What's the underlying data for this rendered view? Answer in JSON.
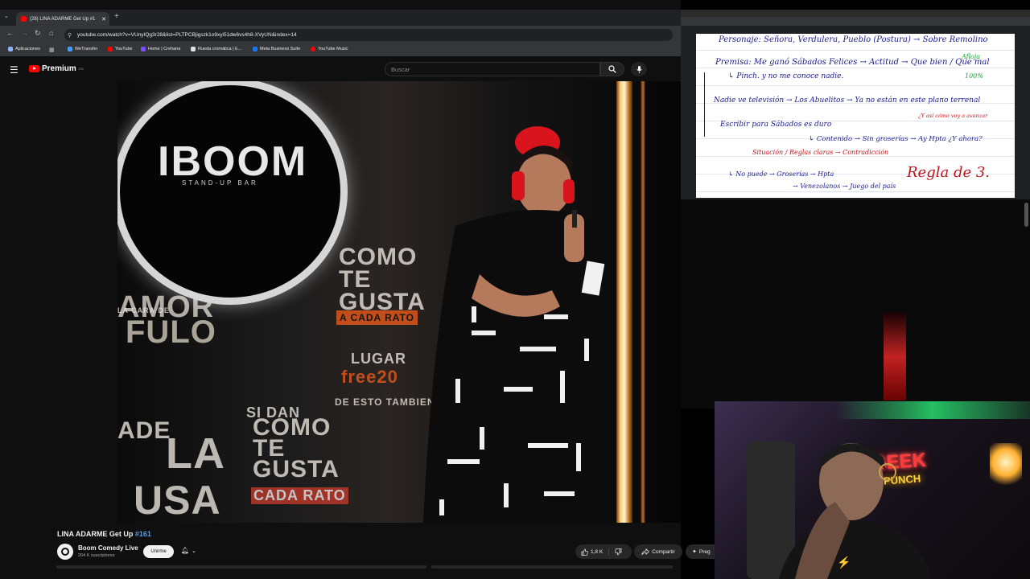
{
  "browser": {
    "tab_title": "(28) LINA ADARME Get Up #1",
    "url": "youtube.com/watch?v=VUnyIQg3r28&list=PLTPCBjigszk1o9xyi51dw6vs4h8-XVyUN&index=14",
    "bookmarks": [
      {
        "label": "Aplicaciones",
        "color": "#8ab4f8"
      },
      {
        "label": "WeTransfer",
        "color": "#409fff"
      },
      {
        "label": "YouTube",
        "color": "#ff0000"
      },
      {
        "label": "Home | Crehana",
        "color": "#7c4dff"
      },
      {
        "label": "Rueda cromática | E...",
        "color": "#e0e0e0"
      },
      {
        "label": "Meta Business Suite",
        "color": "#1877f2"
      },
      {
        "label": "YouTube Music",
        "color": "#ff0000"
      }
    ]
  },
  "youtube": {
    "logo_text": "Premium",
    "logo_sup": "CO",
    "search_placeholder": "Buscar",
    "video_title": "LINA ADARME Get Up ",
    "video_title_hash": "#161",
    "channel_name": "Boom Comedy Live",
    "subscribers": "204 K suscriptores",
    "join_label": "Unirme",
    "likes": "1,8 K",
    "share_label": "Compartir",
    "ask_label": "Preg"
  },
  "video_scene": {
    "logo": "IBOOM",
    "logo_sub": "STAND-UP BAR",
    "wall_texts": [
      "AMOR",
      "COMO TE GUSTA",
      "A CADA RATO",
      "LUGAR",
      "free20",
      "DE ESTO TAMBIEN",
      "COMO TE GUSTA",
      "CADA RATO",
      "LA CARA DE",
      "FULO",
      "SI DAN",
      "ADE",
      "LA",
      "USA"
    ]
  },
  "notes": {
    "lines": [
      {
        "text": "Personaje: Señora, Verdulera, Pueblo  (Postura) → Sobre Remolino",
        "color": "#1a1a8c"
      },
      {
        "text": "Premisa: Me ganó Sábados Felices → Actitud → Que bien / Que mal",
        "color": "#1a1a8c"
      },
      {
        "text": "↳ Pinch. y no me conoce nadie.",
        "color": "#1a1a8c"
      },
      {
        "text": "Nadie ve televisión → Los Abuelitos → Ya no están en este plano terrenal",
        "color": "#1a1a8c"
      },
      {
        "text": "Escribir para Sábados es duro",
        "color": "#1a1a8c"
      },
      {
        "text": "↳ Contenido → Sin groserías → Ay Hpta ¿Y ahora?",
        "color": "#1a1a8c"
      },
      {
        "text": "Situación / Reglas claras → Contradicción",
        "color": "#c0141c"
      },
      {
        "text": "↳ No puede → Groserías → Hpta",
        "color": "#1a1a8c"
      },
      {
        "text": "→ Venezolanos → Juego del país",
        "color": "#1a1a8c"
      },
      {
        "text": "Regla de 3.",
        "color": "#c0141c"
      }
    ],
    "margin_notes": [
      "Afloja",
      "100%",
      "¿Y así cómo voy a avanzar"
    ],
    "margin_color": "#1aa33a"
  },
  "webcam": {
    "sign_main": "GEEK",
    "sign_sub": "PUNCH"
  }
}
